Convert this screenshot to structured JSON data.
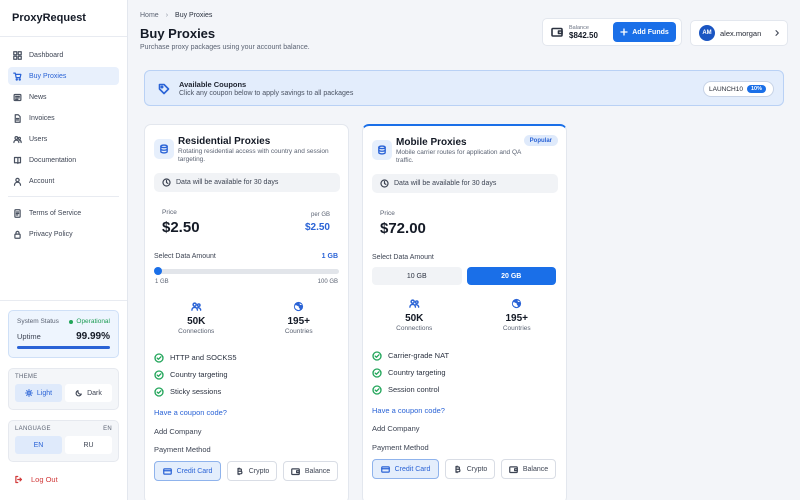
{
  "app": {
    "brand": "ProxyRequest"
  },
  "sidebar": {
    "items": [
      {
        "label": "Dashboard",
        "icon": "grid-icon"
      },
      {
        "label": "Buy Proxies",
        "icon": "cart-icon",
        "active": true
      },
      {
        "label": "News",
        "icon": "newspaper-icon"
      },
      {
        "label": "Invoices",
        "icon": "file-icon"
      },
      {
        "label": "Users",
        "icon": "users-icon"
      },
      {
        "label": "Documentation",
        "icon": "book-icon"
      },
      {
        "label": "Account",
        "icon": "user-icon"
      }
    ],
    "legal": [
      {
        "label": "Terms of Service",
        "icon": "document-icon"
      },
      {
        "label": "Privacy Policy",
        "icon": "lock-icon"
      }
    ],
    "status": {
      "label": "System Status",
      "state": "Operational",
      "uptime_label": "Uptime",
      "uptime_value": "99.99%",
      "uptime_fraction": 0.9999
    },
    "theme": {
      "label": "THEME",
      "light": "Light",
      "dark": "Dark",
      "selected": "Light"
    },
    "language": {
      "label": "LANGUAGE",
      "current": "EN",
      "options": [
        "EN",
        "RU"
      ]
    },
    "logout": "Log Out"
  },
  "header": {
    "breadcrumb": [
      "Home",
      "Buy Proxies"
    ],
    "title": "Buy Proxies",
    "subtitle": "Purchase proxy packages using your account balance.",
    "balance_label": "Balance",
    "balance_value": "$842.50",
    "add_funds": "Add Funds",
    "user_initials": "AM",
    "username": "alex.morgan"
  },
  "coupons": {
    "title": "Available Coupons",
    "subtitle": "Click any coupon below to apply savings to all packages",
    "code": "LAUNCH10",
    "discount": "10%"
  },
  "cards": [
    {
      "title": "Residential Proxies",
      "description": "Rotating residential access with country and session targeting.",
      "availability": "Data will be available for 30 days",
      "price_label": "Price",
      "price": "$2.50",
      "per_gb_label": "per GB",
      "per_gb": "$2.50",
      "select_label": "Select Data Amount",
      "selected_amount": "1 GB",
      "slider_min": "1 GB",
      "slider_max": "100 GB",
      "slider_value_gb": 1,
      "stats": [
        {
          "value": "50K",
          "label": "Connections",
          "icon": "network-icon"
        },
        {
          "value": "195+",
          "label": "Countries",
          "icon": "globe-icon"
        }
      ],
      "features": [
        "HTTP and SOCKS5",
        "Country targeting",
        "Sticky sessions"
      ],
      "coupon_link": "Have a coupon code?",
      "company": "Add Company",
      "payment_label": "Payment Method",
      "payments": [
        "Credit Card",
        "Crypto",
        "Balance"
      ],
      "payment_selected": "Credit Card"
    },
    {
      "title": "Mobile Proxies",
      "badge": "Popular",
      "description": "Mobile carrier routes for application and QA traffic.",
      "availability": "Data will be available for 30 days",
      "price_label": "Price",
      "price": "$72.00",
      "select_label": "Select Data Amount",
      "options": [
        "10 GB",
        "20 GB"
      ],
      "option_selected": "20 GB",
      "stats": [
        {
          "value": "50K",
          "label": "Connections",
          "icon": "network-icon"
        },
        {
          "value": "195+",
          "label": "Countries",
          "icon": "globe-icon"
        }
      ],
      "features": [
        "Carrier-grade NAT",
        "Country targeting",
        "Session control"
      ],
      "coupon_link": "Have a coupon code?",
      "company": "Add Company",
      "payment_label": "Payment Method",
      "payments": [
        "Credit Card",
        "Crypto",
        "Balance"
      ],
      "payment_selected": "Credit Card"
    }
  ],
  "colors": {
    "accent": "#1a6fe8",
    "success": "#22a55a",
    "danger": "#d23b3b",
    "background": "#f3f5f9"
  }
}
